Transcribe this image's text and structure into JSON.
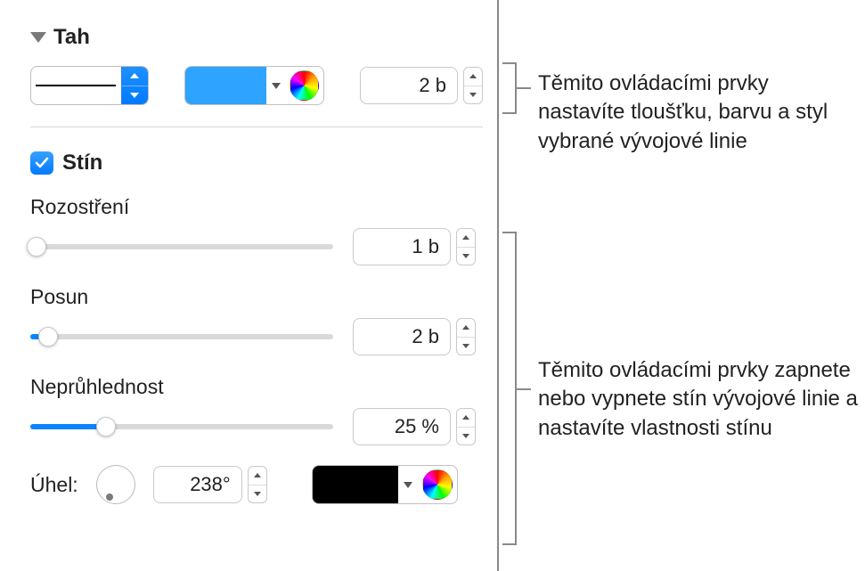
{
  "sections": {
    "stroke": {
      "title": "Tah",
      "line_style": "solid",
      "color": "#2ea3ff",
      "width_value": "2 b"
    },
    "shadow": {
      "checkbox_label": "Stín",
      "checked": true,
      "blur": {
        "label": "Rozostření",
        "value": "1 b",
        "percent": 2
      },
      "offset": {
        "label": "Posun",
        "value": "2 b",
        "percent": 6
      },
      "opacity": {
        "label": "Neprůhlednost",
        "value": "25 %",
        "percent": 25
      },
      "angle": {
        "label": "Úhel:",
        "value": "238°",
        "deg": 238
      },
      "color": "#000000"
    }
  },
  "callouts": {
    "stroke": "Těmito ovládacími prvky nastavíte tloušťku, barvu a styl vybrané vývojové linie",
    "shadow": "Těmito ovládacími prvky zapnete nebo vypnete stín vývojové linie a nastavíte vlastnosti stínu"
  }
}
